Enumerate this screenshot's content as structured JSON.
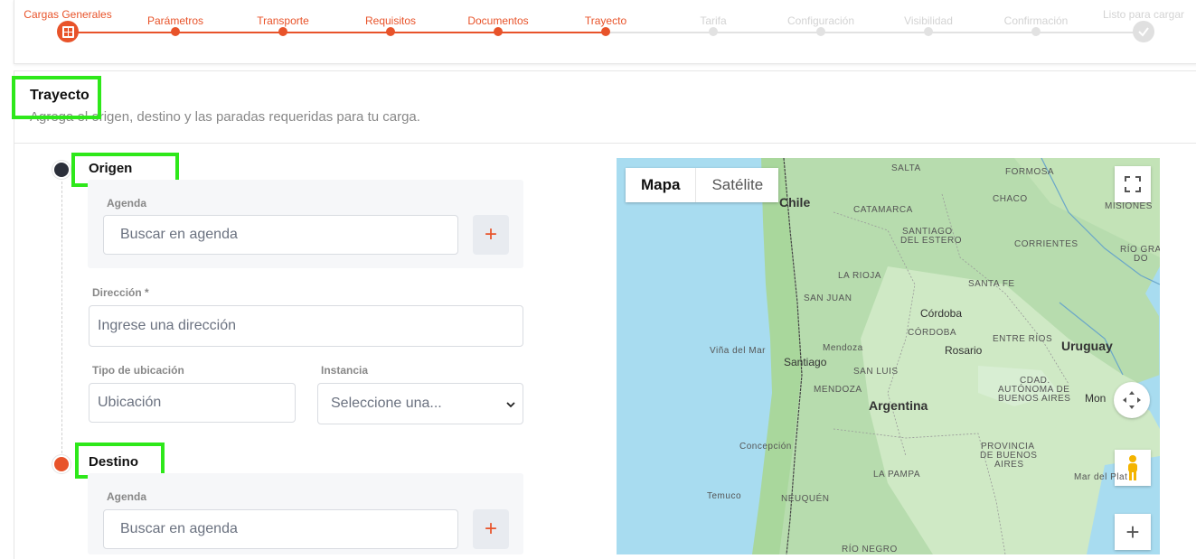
{
  "stepper": {
    "steps": [
      {
        "label": "Cargas Generales"
      },
      {
        "label": "Parámetros"
      },
      {
        "label": "Transporte"
      },
      {
        "label": "Requisitos"
      },
      {
        "label": "Documentos"
      },
      {
        "label": "Trayecto"
      },
      {
        "label": "Tarifa"
      },
      {
        "label": "Configuración"
      },
      {
        "label": "Visibilidad"
      },
      {
        "label": "Confirmación"
      },
      {
        "label": "Listo para cargar"
      }
    ],
    "active_color": "#e8532a",
    "inactive_color": "#d9d9d9"
  },
  "section": {
    "title": "Trayecto",
    "subtitle": "Agrega el origen, destino y las paradas requeridas para tu carga."
  },
  "origin": {
    "title": "Origen",
    "agenda_label": "Agenda",
    "agenda_placeholder": "Buscar en agenda",
    "address_label": "Dirección *",
    "address_placeholder": "Ingrese una dirección",
    "location_type_label": "Tipo de ubicación",
    "location_type_placeholder": "Ubicación",
    "instance_label": "Instancia",
    "instance_value": "Seleccione una..."
  },
  "destination": {
    "title": "Destino",
    "agenda_label": "Agenda",
    "agenda_placeholder": "Buscar en agenda"
  },
  "map": {
    "type_map": "Mapa",
    "type_satellite": "Satélite",
    "labels": {
      "salta": "SALTA",
      "formosa": "FORMOSA",
      "chaco": "CHACO",
      "misiones": "MISIONES",
      "catamarca": "CATAMARCA",
      "santiago_estero_1": "SANTIAGO",
      "santiago_estero_2": "DEL ESTERO",
      "corrientes": "CORRIENTES",
      "rio_grande": "RÍO GRA",
      "do": "DO",
      "la_rioja": "LA RIOJA",
      "santa_fe": "SANTA FE",
      "san_juan": "SAN JUAN",
      "cordoba_city": "Córdoba",
      "cordoba": "CÓRDOBA",
      "entre_rios": "ENTRE RÍOS",
      "uruguay": "Uruguay",
      "rosario": "Rosario",
      "vina": "Viña del Mar",
      "mendoza_city": "Mendoza",
      "santiago": "Santiago",
      "san_luis": "SAN LUIS",
      "mendoza": "MENDOZA",
      "argentina": "Argentina",
      "cdad_1": "CDAD.",
      "cdad_2": "AUTÓNOMA DE",
      "cdad_3": "BUENOS AIRES",
      "montevideo": "Mon",
      "chile": "Chile",
      "concepcion": "Concepción",
      "provincia_1": "PROVINCIA",
      "provincia_2": "DE BUENOS",
      "provincia_3": "AIRES",
      "la_pampa": "LA PAMPA",
      "mar_del_plata": "Mar del Plat",
      "temuco": "Temuco",
      "neuquen": "NEUQUÉN",
      "rio_negro": "RÍO NEGRO"
    }
  }
}
